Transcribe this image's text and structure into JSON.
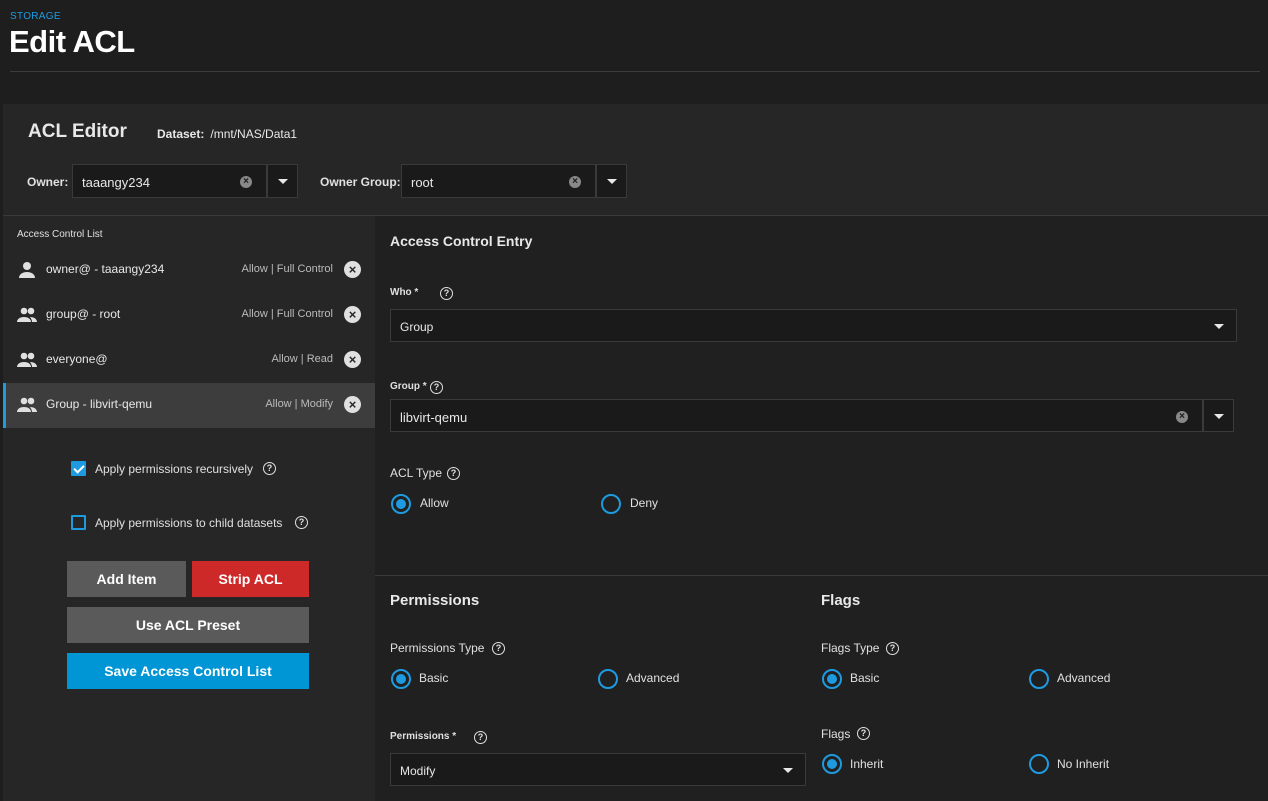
{
  "breadcrumb": "STORAGE",
  "page_title": "Edit ACL",
  "editor": {
    "title": "ACL Editor",
    "dataset_label": "Dataset:",
    "dataset_value": "/mnt/NAS/Data1",
    "owner_label": "Owner:",
    "owner_value": "taaangy234",
    "owner_group_label": "Owner Group:",
    "owner_group_value": "root"
  },
  "acl_list": {
    "heading": "Access Control List",
    "items": [
      {
        "icon": "person-icon",
        "name": "owner@ - taaangy234",
        "perm": "Allow | Full Control"
      },
      {
        "icon": "group-icon",
        "name": "group@ - root",
        "perm": "Allow | Full Control"
      },
      {
        "icon": "group-icon",
        "name": "everyone@",
        "perm": "Allow | Read"
      },
      {
        "icon": "group-icon",
        "name": "Group - libvirt-qemu",
        "perm": "Allow | Modify",
        "selected": true
      }
    ]
  },
  "options": {
    "recursive_label": "Apply permissions recursively",
    "recursive_checked": true,
    "child_label": "Apply permissions to child datasets",
    "child_checked": false
  },
  "buttons": {
    "add_item": "Add Item",
    "strip_acl": "Strip ACL",
    "use_preset": "Use ACL Preset",
    "save": "Save Access Control List"
  },
  "entry": {
    "title": "Access Control Entry",
    "who_label": "Who *",
    "who_value": "Group",
    "group_label": "Group *",
    "group_value": "libvirt-qemu",
    "acl_type_label": "ACL Type",
    "acl_type_options": [
      "Allow",
      "Deny"
    ],
    "acl_type_selected": "Allow"
  },
  "permissions": {
    "title": "Permissions",
    "type_label": "Permissions Type",
    "type_options": [
      "Basic",
      "Advanced"
    ],
    "type_selected": "Basic",
    "perm_label": "Permissions *",
    "perm_value": "Modify"
  },
  "flags": {
    "title": "Flags",
    "type_label": "Flags Type",
    "type_options": [
      "Basic",
      "Advanced"
    ],
    "type_selected": "Basic",
    "flags_label": "Flags",
    "flags_options": [
      "Inherit",
      "No Inherit"
    ],
    "flags_selected": "Inherit"
  },
  "colors": {
    "accent": "#1e9be0",
    "danger": "#ce2929",
    "primary": "#0095d5"
  }
}
